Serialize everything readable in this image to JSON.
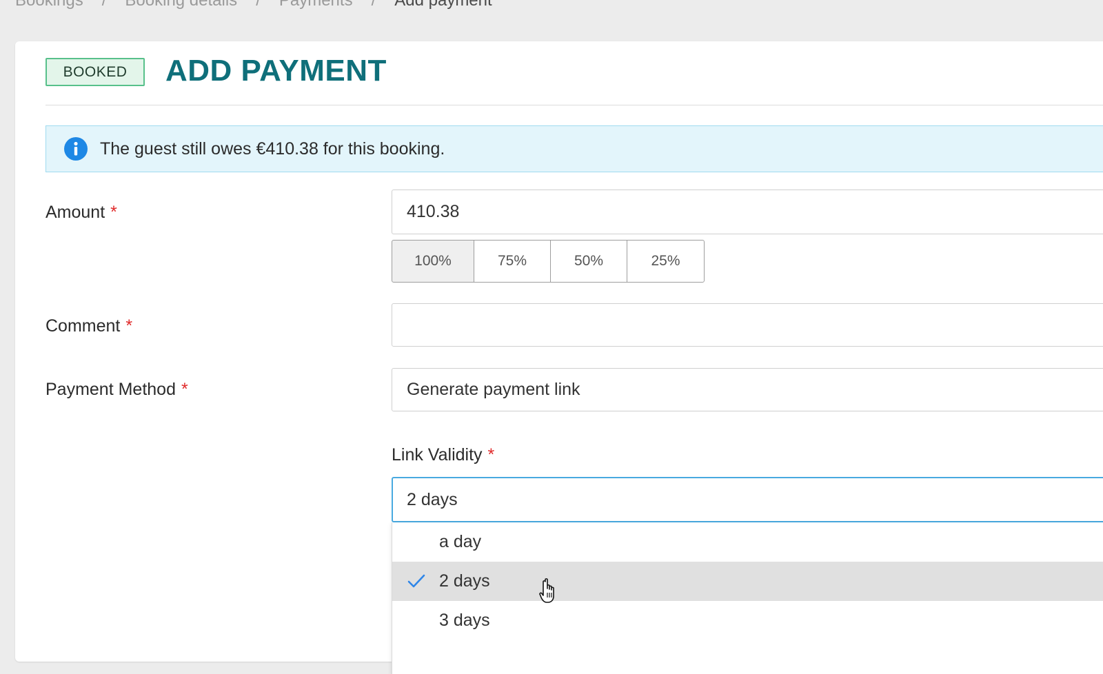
{
  "breadcrumb": {
    "items": [
      "Bookings",
      "Booking details",
      "Payments"
    ],
    "current": "Add payment",
    "separator": "/"
  },
  "header": {
    "badge": "BOOKED",
    "title": "ADD PAYMENT"
  },
  "alert": {
    "text": "The guest still owes €410.38 for this booking."
  },
  "form": {
    "amount": {
      "label": "Amount",
      "required_mark": "*",
      "value": "410.38",
      "percent_buttons": [
        "100%",
        "75%",
        "50%",
        "25%"
      ]
    },
    "comment": {
      "label": "Comment",
      "required_mark": "*",
      "value": ""
    },
    "payment_method": {
      "label": "Payment Method",
      "required_mark": "*",
      "value": "Generate payment link"
    },
    "link_validity": {
      "label": "Link Validity",
      "required_mark": "*",
      "value": "2 days",
      "options": [
        "a day",
        "2 days",
        "3 days"
      ]
    }
  },
  "colors": {
    "accent": "#0f6f7a",
    "badge_border": "#57c08a",
    "info_blue": "#1e88e5",
    "required": "#e02a2a",
    "focus_border": "#48a9e0"
  }
}
